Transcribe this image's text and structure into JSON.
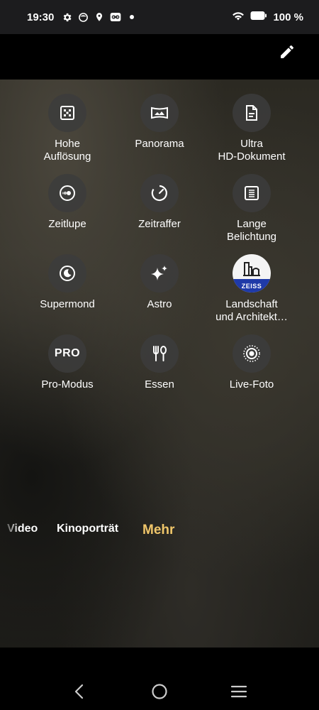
{
  "status_bar": {
    "time": "19:30",
    "battery": "100 %",
    "icons": [
      "gear-icon",
      "face-icon",
      "location-icon",
      "link-icon",
      "dot-icon",
      "wifi-icon",
      "battery-icon"
    ]
  },
  "toolbar": {
    "edit_icon": "pencil-icon"
  },
  "modes": [
    {
      "label": "Hohe\nAuflösung",
      "icon": "high-resolution-icon"
    },
    {
      "label": "Panorama",
      "icon": "panorama-icon"
    },
    {
      "label": "Ultra\nHD-Dokument",
      "icon": "document-icon"
    },
    {
      "label": "Zeitlupe",
      "icon": "slow-motion-icon"
    },
    {
      "label": "Zeitraffer",
      "icon": "timelapse-icon"
    },
    {
      "label": "Lange\nBelichtung",
      "icon": "long-exposure-icon"
    },
    {
      "label": "Supermond",
      "icon": "moon-icon"
    },
    {
      "label": "Astro",
      "icon": "stars-icon"
    },
    {
      "label": "Landschaft\nund Architekt…",
      "icon": "zeiss-icon",
      "badge": "ZEISS"
    },
    {
      "label": "Pro-Modus",
      "icon": "pro-icon",
      "badge": "PRO"
    },
    {
      "label": "Essen",
      "icon": "food-icon"
    },
    {
      "label": "Live-Foto",
      "icon": "live-photo-icon"
    }
  ],
  "mode_tabs": {
    "video": "Video",
    "kino": "Kinoporträt",
    "mehr": "Mehr"
  },
  "colors": {
    "accent": "#f0c66a",
    "icon_bg": "#3c3c3c",
    "zeiss_blue": "#1f3aa8"
  }
}
